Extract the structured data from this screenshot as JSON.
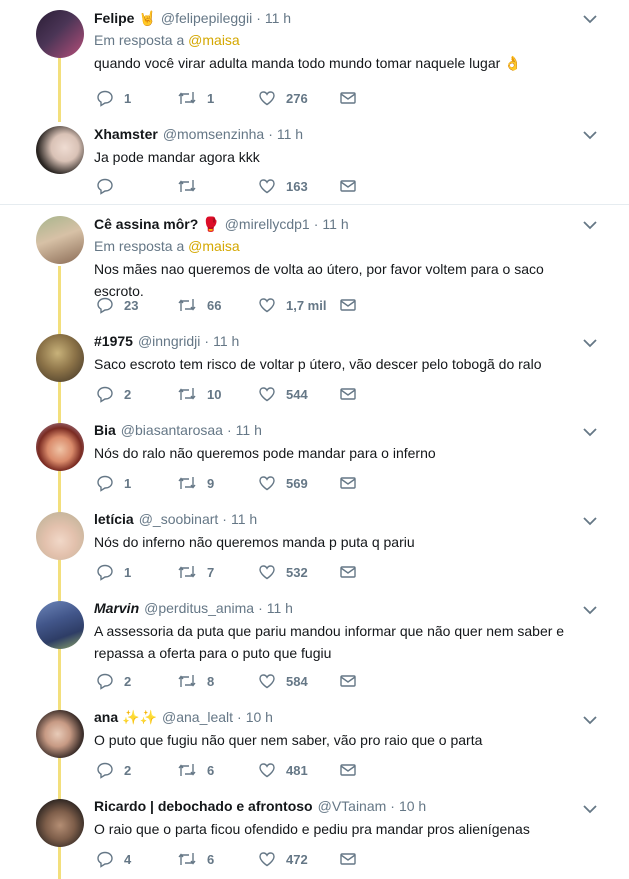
{
  "colors": {
    "accent": "#f3df7c",
    "mention": "#d4a700",
    "muted": "#657786",
    "text": "#14171a"
  },
  "tweets": [
    {
      "name": "Felipe",
      "emoji": "🤘",
      "handle": "@felipepileggii",
      "time": "11 h",
      "replying_prefix": "Em resposta a",
      "replying_to": "@maisa",
      "text": "quando você virar adulta manda todo mundo tomar naquele lugar 👌",
      "replies": "1",
      "retweets": "1",
      "likes": "276"
    },
    {
      "name": "Xhamster",
      "emoji": "",
      "handle": "@momsenzinha",
      "time": "11 h",
      "text": "Ja pode mandar agora kkk",
      "replies": "",
      "retweets": "",
      "likes": "163"
    },
    {
      "name": "Cê assina môr?",
      "emoji": "🥊",
      "handle": "@mirellycdp1",
      "time": "11 h",
      "replying_prefix": "Em resposta a",
      "replying_to": "@maisa",
      "text": "Nos mães nao queremos de volta ao útero, por favor voltem para o saco escroto.",
      "replies": "23",
      "retweets": "66",
      "likes": "1,7 mil"
    },
    {
      "name": "#1975",
      "emoji": "",
      "handle": "@inngridji",
      "time": "11 h",
      "text": "Saco escroto tem risco de voltar p útero, vão descer pelo tobogã do ralo",
      "replies": "2",
      "retweets": "10",
      "likes": "544"
    },
    {
      "name": "Bia",
      "emoji": "",
      "handle": "@biasantarosaa",
      "time": "11 h",
      "text": "Nós do ralo não queremos pode mandar para o inferno",
      "replies": "1",
      "retweets": "9",
      "likes": "569"
    },
    {
      "name": "letícia",
      "emoji": "",
      "handle": "@_soobinart",
      "time": "11 h",
      "text": "Nós do inferno não queremos manda p puta q pariu",
      "replies": "1",
      "retweets": "7",
      "likes": "532"
    },
    {
      "name": "Marvin",
      "emoji": "",
      "handle": "@perditus_anima",
      "time": "11 h",
      "text": "A assessoria da puta que pariu mandou informar que não quer nem saber e repassa a oferta para o puto que fugiu",
      "replies": "2",
      "retweets": "8",
      "likes": "584"
    },
    {
      "name": "ana",
      "emoji": "✨✨",
      "handle": "@ana_lealt",
      "time": "10 h",
      "text": "O puto que fugiu não quer nem saber, vão pro raio que o parta",
      "replies": "2",
      "retweets": "6",
      "likes": "481"
    },
    {
      "name": "Ricardo | debochado e afrontoso",
      "emoji": "",
      "handle": "@VTainam",
      "time": "10 h",
      "text": "O raio que o parta ficou ofendido e pediu pra mandar pros alienígenas",
      "replies": "4",
      "retweets": "6",
      "likes": "472"
    }
  ]
}
